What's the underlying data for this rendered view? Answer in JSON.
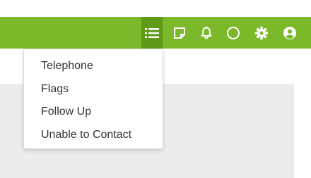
{
  "colors": {
    "topbar_bg": "#7cb92a",
    "topbar_active_bg": "#5e9a18",
    "icon_color": "#ffffff",
    "menu_text": "#333333",
    "content_bg": "#ececec"
  },
  "topbar": {
    "icons": [
      "list-icon",
      "note-icon",
      "bell-icon",
      "circle-icon",
      "gear-icon",
      "user-avatar-icon"
    ],
    "active_icon": "list-icon"
  },
  "dropdown": {
    "items": [
      {
        "label": "Telephone"
      },
      {
        "label": "Flags"
      },
      {
        "label": "Follow Up"
      },
      {
        "label": "Unable to Contact"
      }
    ]
  }
}
